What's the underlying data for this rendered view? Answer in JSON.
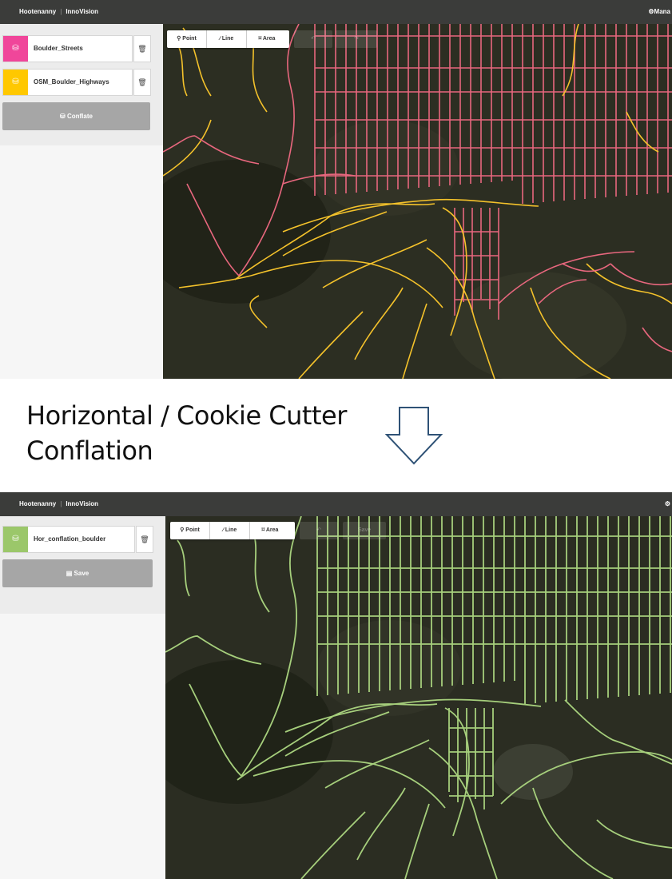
{
  "top": {
    "brand": "Hootenanny",
    "product": "InnoVision",
    "manage_label": "Mana",
    "layers": [
      {
        "name": "Boulder_Streets",
        "color": "#f0469a",
        "icon": "database-icon"
      },
      {
        "name": "OSM_Boulder_Highways",
        "color": "#ffc800",
        "icon": "database-icon"
      }
    ],
    "action_label": "Conflate",
    "action_icon": "layers-stack-icon",
    "tools": [
      {
        "label": "Point",
        "icon": "map-pin-icon"
      },
      {
        "label": "Line",
        "icon": "pencil-icon"
      },
      {
        "label": "Area",
        "icon": "polygon-icon"
      }
    ],
    "road_color": "#e8677e",
    "trail_color": "#f4c22b"
  },
  "caption": {
    "line1": "Horizontal / Cookie Cutter",
    "line2": "Conflation"
  },
  "bottom": {
    "brand": "Hootenanny",
    "product": "InnoVision",
    "layers": [
      {
        "name": "Hor_conflation_boulder",
        "color": "#9bc76a",
        "icon": "database-icon"
      }
    ],
    "action_label": "Save",
    "action_icon": "save-icon",
    "tools": [
      {
        "label": "Point",
        "icon": "map-pin-icon"
      },
      {
        "label": "Line",
        "icon": "pencil-icon"
      },
      {
        "label": "Area",
        "icon": "polygon-icon"
      }
    ],
    "save_ghost": "Save",
    "road_color": "#a6cf7c"
  }
}
